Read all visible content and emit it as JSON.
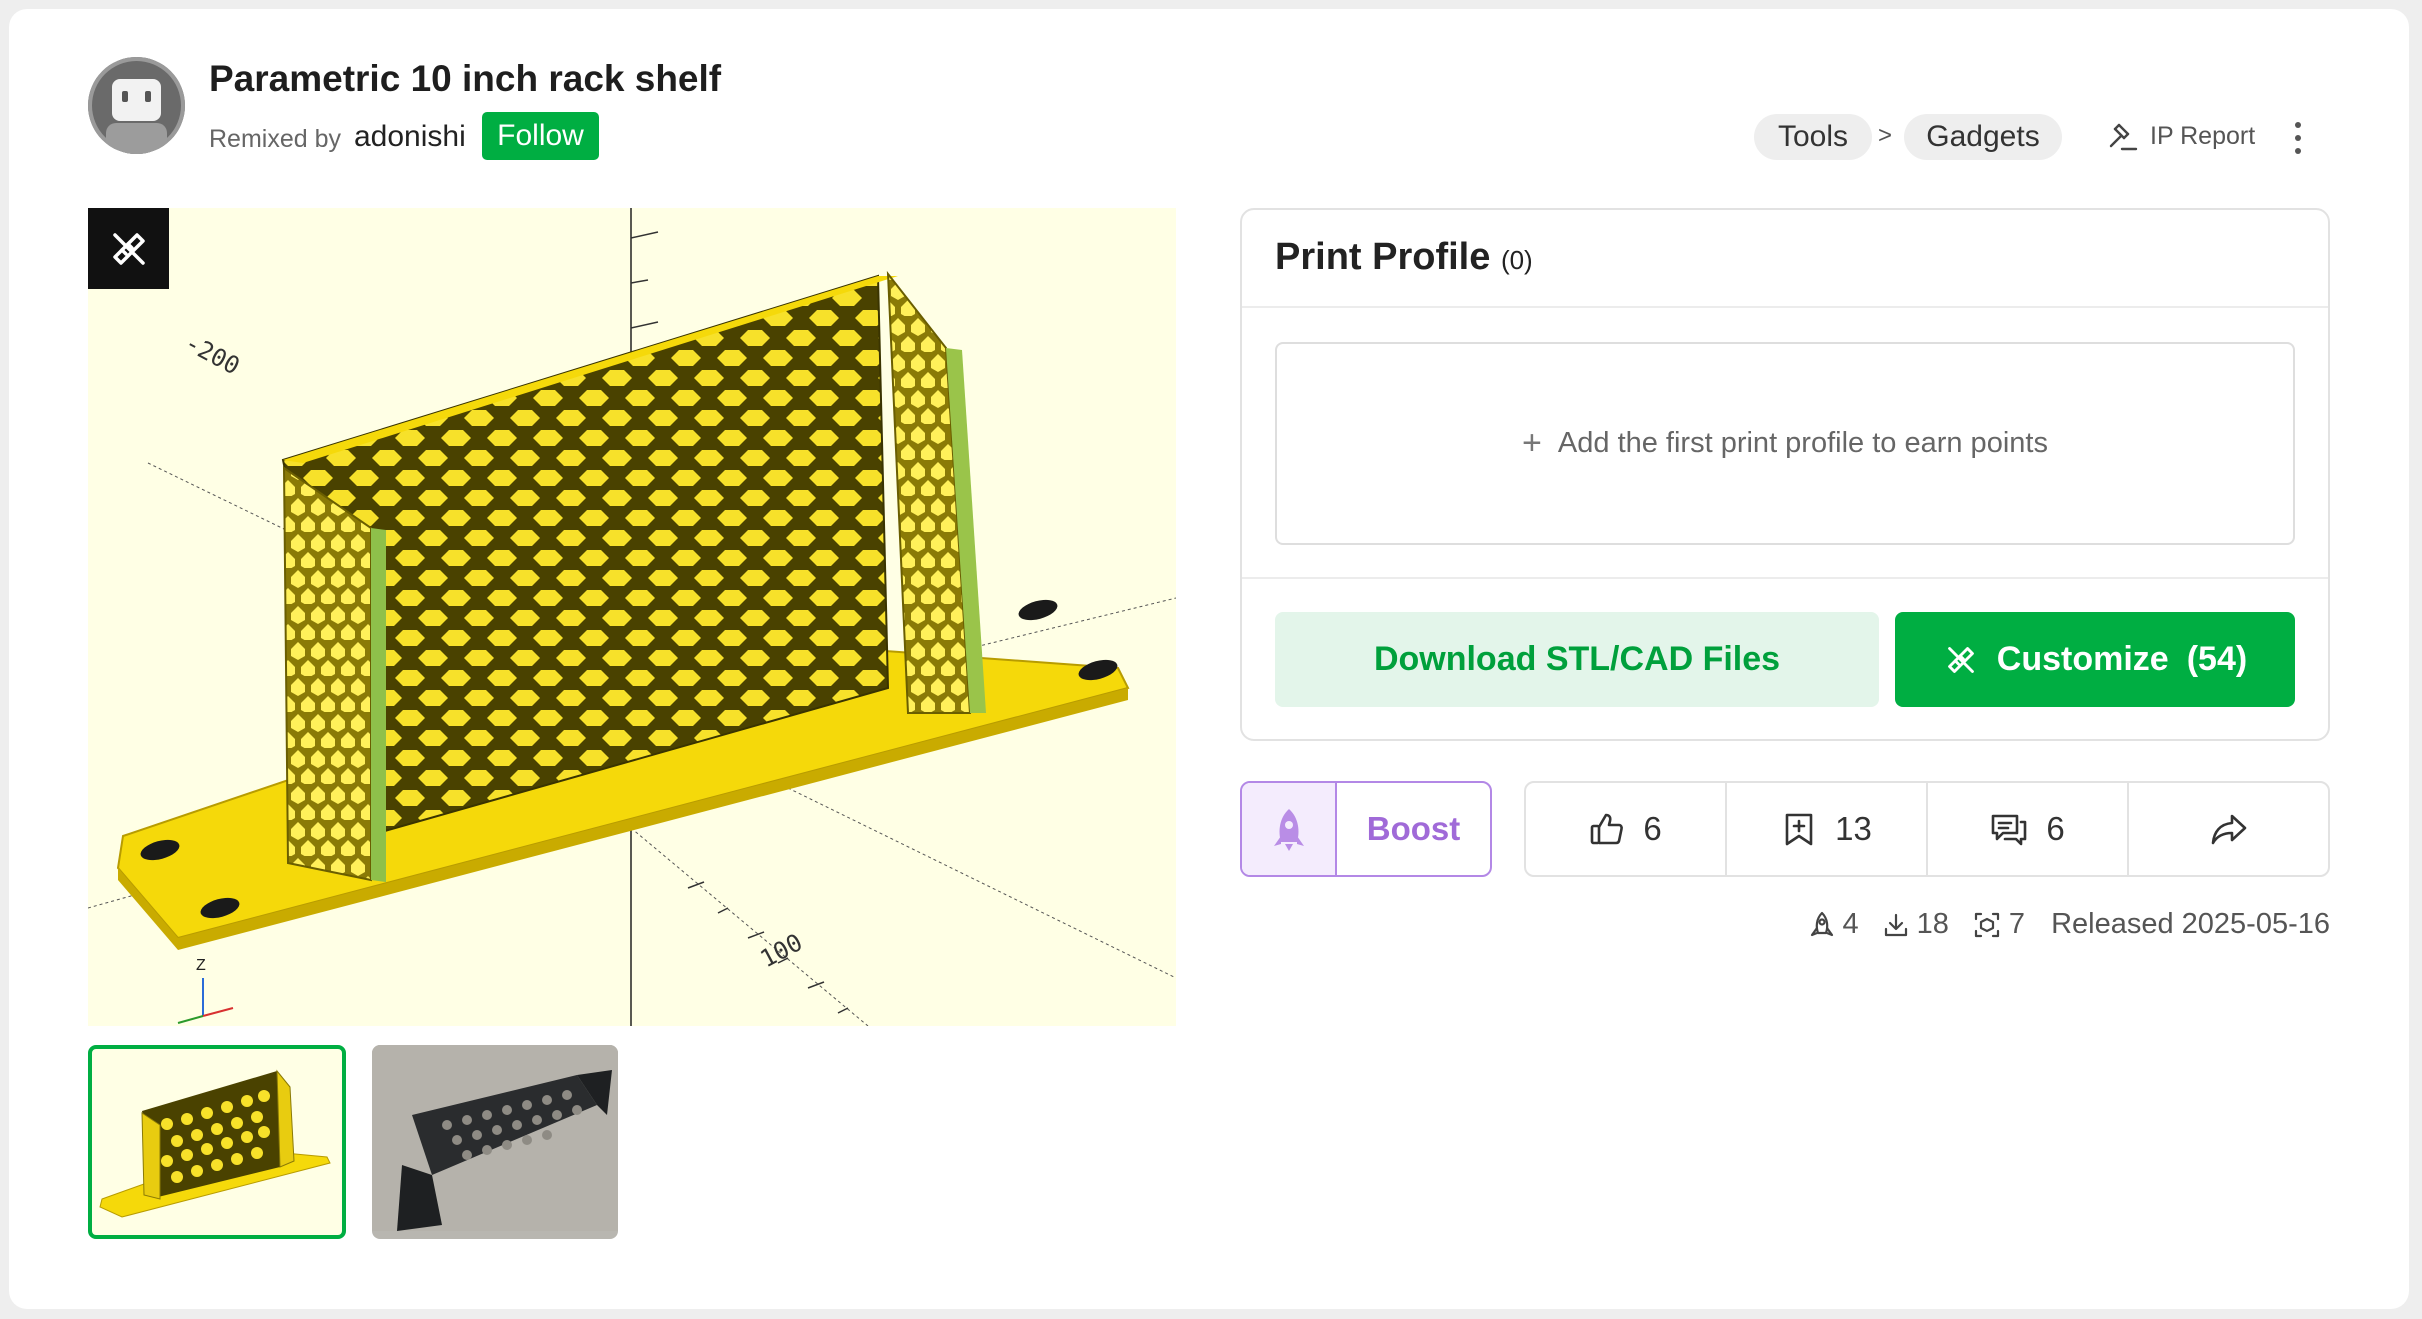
{
  "header": {
    "title": "Parametric 10 inch rack shelf",
    "remixed_label": "Remixed by",
    "author": "adonishi",
    "follow_label": "Follow",
    "breadcrumb": [
      "Tools",
      "Gadgets"
    ],
    "breadcrumb_separator": ">",
    "ip_report_label": "IP Report"
  },
  "viewer": {
    "axis_label_top": "-200",
    "axis_label_bottom": "100",
    "axis_z_label": "Z"
  },
  "print_profile": {
    "title": "Print Profile",
    "count": "(0)",
    "add_label": "Add the first print profile to earn points",
    "download_label": "Download STL/CAD Files",
    "customize_label": "Customize",
    "customize_count": "(54)"
  },
  "actions": {
    "boost_label": "Boost",
    "likes": "6",
    "collections": "13",
    "comments": "6"
  },
  "meta": {
    "boosts": "4",
    "downloads": "18",
    "prints": "7",
    "released": "Released 2025-05-16"
  },
  "colors": {
    "brand_green": "#00ae42",
    "boost_purple": "#a06ad8",
    "viewer_bg": "#ffffe5",
    "model_yellow": "#f5d90a"
  }
}
